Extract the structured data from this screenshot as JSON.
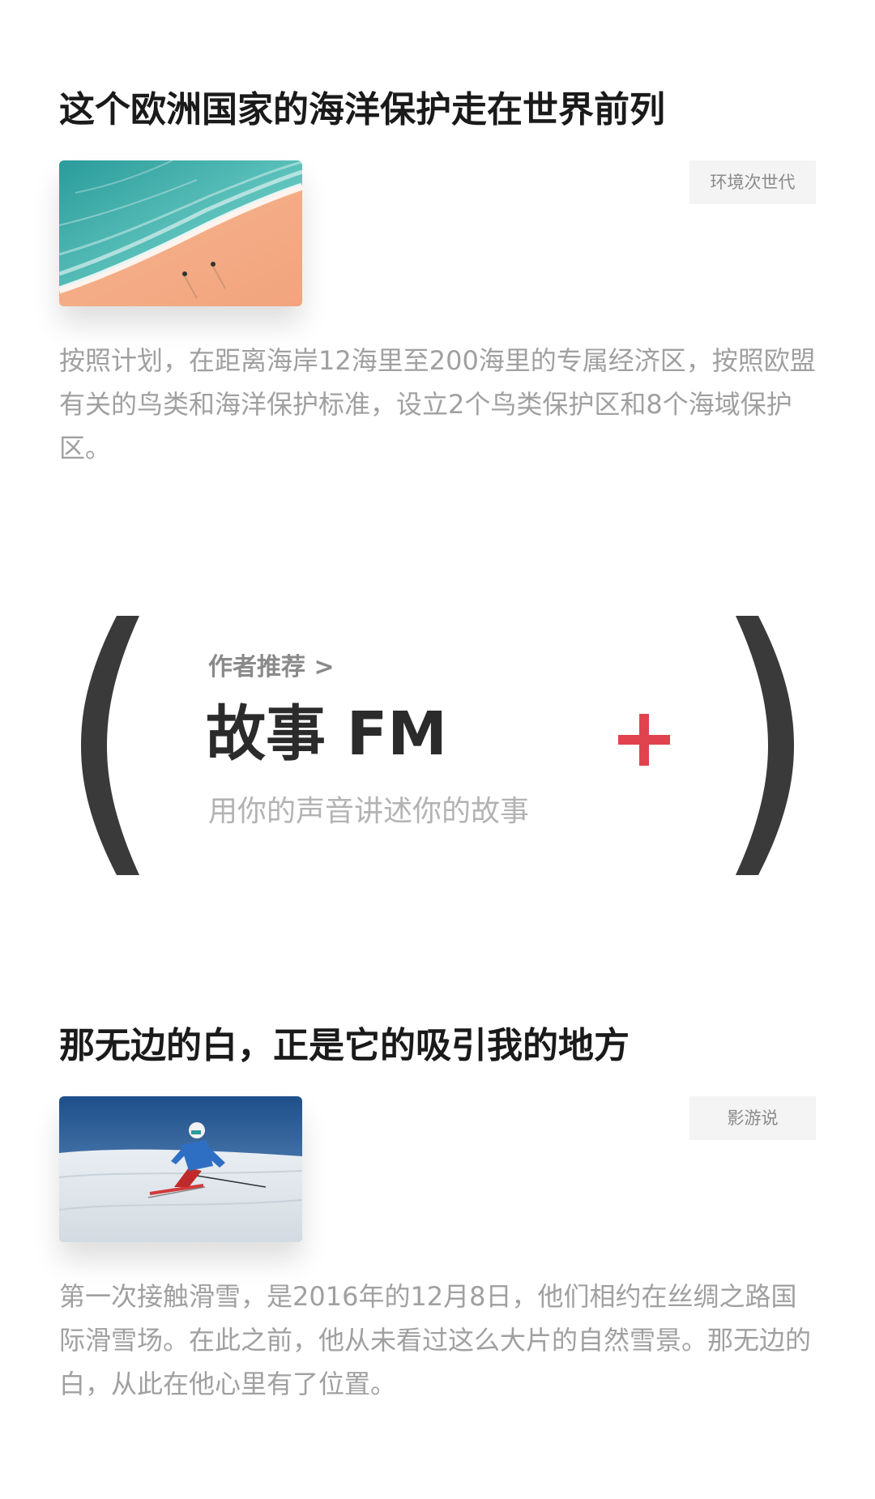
{
  "articles": [
    {
      "title": "这个欧洲国家的海洋保护走在世界前列",
      "tag": "环境次世代",
      "summary": "按照计划，在距离海岸12海里至200海里的专属经济区，按照欧盟有关的鸟类和海洋保护标准，设立2个鸟类保护区和8个海域保护区。",
      "image": "beach-aerial-photo"
    },
    {
      "title": "那无边的白，正是它的吸引我的地方",
      "tag": "影游说",
      "summary": "第一次接触滑雪，是2016年的12月8日，他们相约在丝绸之路国际滑雪场。在此之前，他从未看过这么大片的自然雪景。那无边的白，从此在他心里有了位置。",
      "image": "skier-photo"
    }
  ],
  "recommendation": {
    "kicker": "作者推荐 >",
    "title": "故事 FM",
    "subtitle": "用你的声音讲述你的故事",
    "add_icon": "plus-icon",
    "accent_color": "#e0434d"
  }
}
